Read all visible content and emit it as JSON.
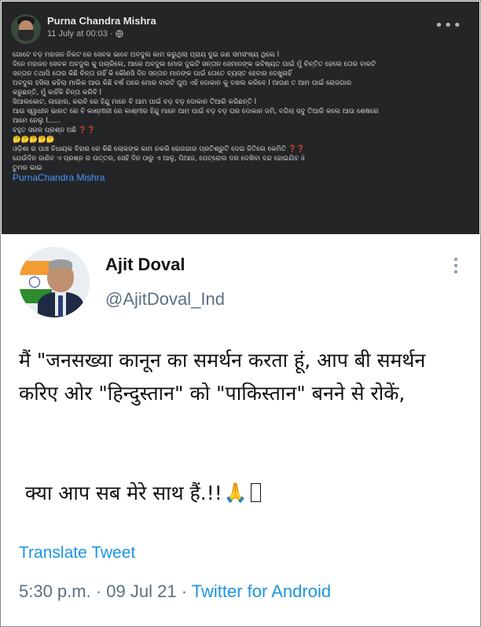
{
  "facebook_post": {
    "author": "Purna Chandra Mishra",
    "date": "11 July at 00:03",
    "separator": "·",
    "privacy_icon": "globe-icon",
    "menu_icon": "more-dots-icon",
    "lines": [
      "ଗୋଟେ ବଡ଼ ମହାଜନ ନିକଟ ରେ ସେବକ ଭାବେ ଅବଦୁଲ କାମ କରୁଥିଲା ପ୍ରାୟ ଦୁଇ ଜଣ ସମସଂଖ୍ୟ ଥିଲେ l",
      "ଦିନେ ମହାଜନ ସେବକ ଅବଦୁଲ କୁ ପଚାରିଲେ, ଆରେ ଅବଦୁଲ ମୋର ଦୁଇଟି ସନ୍ତାନ ସେମାନଙ୍କ ଭବିଷ୍ୟତ ପାଇଁ ମୁଁ ଚିନ୍ତିତ ହେଲେ ତୋର ବାରଟି",
      "ସନ୍ତାନ ତଥାପି ତୋର କିଛି ଚିନ୍ତା ନାହିଁ କି କୌଣସି ଦିନ ସନ୍ତାନ ମାନଙ୍କ ପାଇଁ ତୋତେ ବ୍ୟସ୍ତ ହେବାର ଦେଖୁନାହିଁ",
      "ଅବଦୁଲ ହସିଲା କହିଲା ମାଲିକ ଆଉ କିଛି ବର୍ଷ ପରେ ମୋର ବାରଟି ପୁଅ ଏହି ଦୋକାନ କୁ ଦଖଲ କରିବେ l ଆପଣ ତ ଆମ ପାଇଁ ରୋଜଗାର",
      "କରୁଛନ୍ତି, ମୁଁ କାହିଁକି ଚିନ୍ତା କରିବି l",
      "ସିଆଲକୋଟ, ଲାହୋର, କରାଚି ରେ ହିନ୍ଦୁ ମାନେ ବି ଆମ ପାଇଁ ବଡ଼ ବଡ଼ ଦୋକାନ ତିଆରି କରିଛନ୍ତି l",
      "ଆଉ ସ୍ୱାଧୀନ ଭାରତ ରେ ବି କାଶ୍ମୀରୀ ରେ କାଶ୍ମୀର ହିନ୍ଦୁ ମାନେ ଆମ ପାଇଁ ବଡ଼ ବଡ଼ ଘର ଦୋକାନ ଜମି, ବଗିଚା ସବୁ ତିଆରି କଲେ ଆଉ ଶେଷରେ",
      "ଆମେ ନେଲୁ l......",
      "ବହୁତ ସରଳ ପ୍ରଶ୍ନ ଅଛି",
      "🤔🤔🤔🤔🤔",
      "ଓଡ଼ିଶା ର ପାଞ୍ଚ ବିଧାୟକ ବିହାର ରେ କିଛି ଲୋକଙ୍କ କାମ ନକରି ରୋଜଗାର ପ୍ରତିଶ୍ରୁତି ଦେଇ ଜିତିଲେ କେମିତି",
      "ଯେଉଁଦିନ ଜାଣିବ ଏ ପ୍ରଶ୍ନ ର ଉତ୍ତର, ସେହି ଦିନ ଠାରୁ ଏ ଆଳୁ, ପିଆଜ, ପେଟ୍ରୋଲ ଦର ଦେଖିବା ବନ୍ଦ ହୋଇଯିବ ii",
      "ତୁମର ଭାଇ"
    ],
    "question_marks": "❓❓",
    "hashtag_link": "PurnaChandra Mishra"
  },
  "tweet": {
    "name": "Ajit Doval",
    "handle": "@AjitDoval_Ind",
    "menu_icon": "vertical-dots-icon",
    "text": "मैं \"जनसख्या कानून का समर्थन करता हूं, आप बी समर्थन करिए ओर \"हिन्दुस्तान\" को \"पाकिस्तान\" बनने से रोकें,",
    "question": "क्या आप सब मेरे साथ हैं.!!",
    "emoji": "🙏",
    "translate_label": "Translate Tweet",
    "time": "5:30 p.m.",
    "date": "09 Jul 21",
    "dot": "·",
    "source": "Twitter for Android"
  }
}
